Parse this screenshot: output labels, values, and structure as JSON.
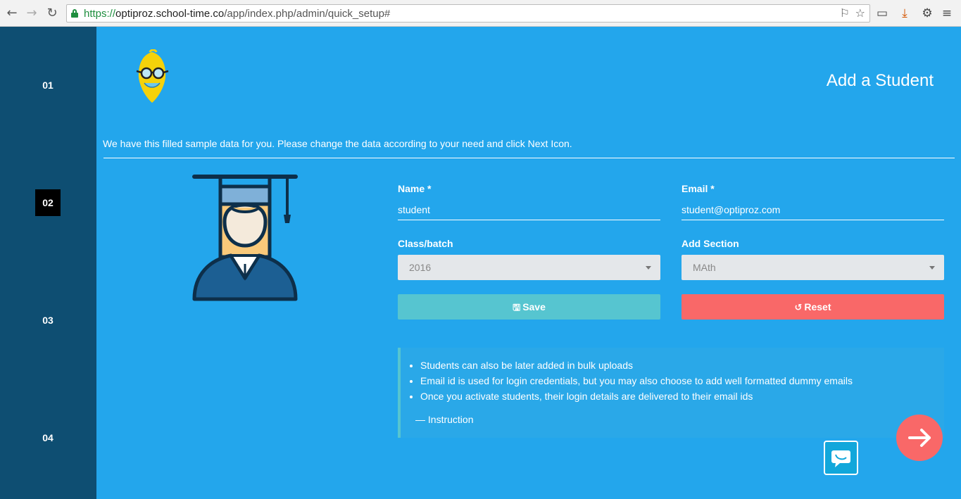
{
  "browser": {
    "url_scheme": "https://",
    "url_host": "optiproz.school-time.co",
    "url_path": "/app/index.php/admin/quick_setup#"
  },
  "sidebar": {
    "steps": [
      {
        "label": "01",
        "active": false
      },
      {
        "label": "02",
        "active": true
      },
      {
        "label": "03",
        "active": false
      },
      {
        "label": "04",
        "active": false
      }
    ]
  },
  "header": {
    "title": "Add a Student"
  },
  "intro_text": "We have this filled sample data for you. Please change the data according to your need and click Next Icon.",
  "form": {
    "name": {
      "label": "Name *",
      "value": "student"
    },
    "email": {
      "label": "Email *",
      "value": "student@optiproz.com"
    },
    "class_batch": {
      "label": "Class/batch",
      "value": "2016"
    },
    "section": {
      "label": "Add Section",
      "value": "MAth"
    },
    "save_label": "Save",
    "reset_label": "Reset"
  },
  "instructions": {
    "items": [
      "Students can also be later added in bulk uploads",
      "Email id is used for login credentials, but you may also choose to add well formatted dummy emails",
      "Once you activate students, their login details are delivered to their email ids"
    ],
    "cite": "— Instruction"
  },
  "colors": {
    "main_bg": "#23a6ec",
    "sidebar_bg": "#0e4e72",
    "save": "#56c5d0",
    "reset": "#f96868",
    "next": "#f96868"
  }
}
